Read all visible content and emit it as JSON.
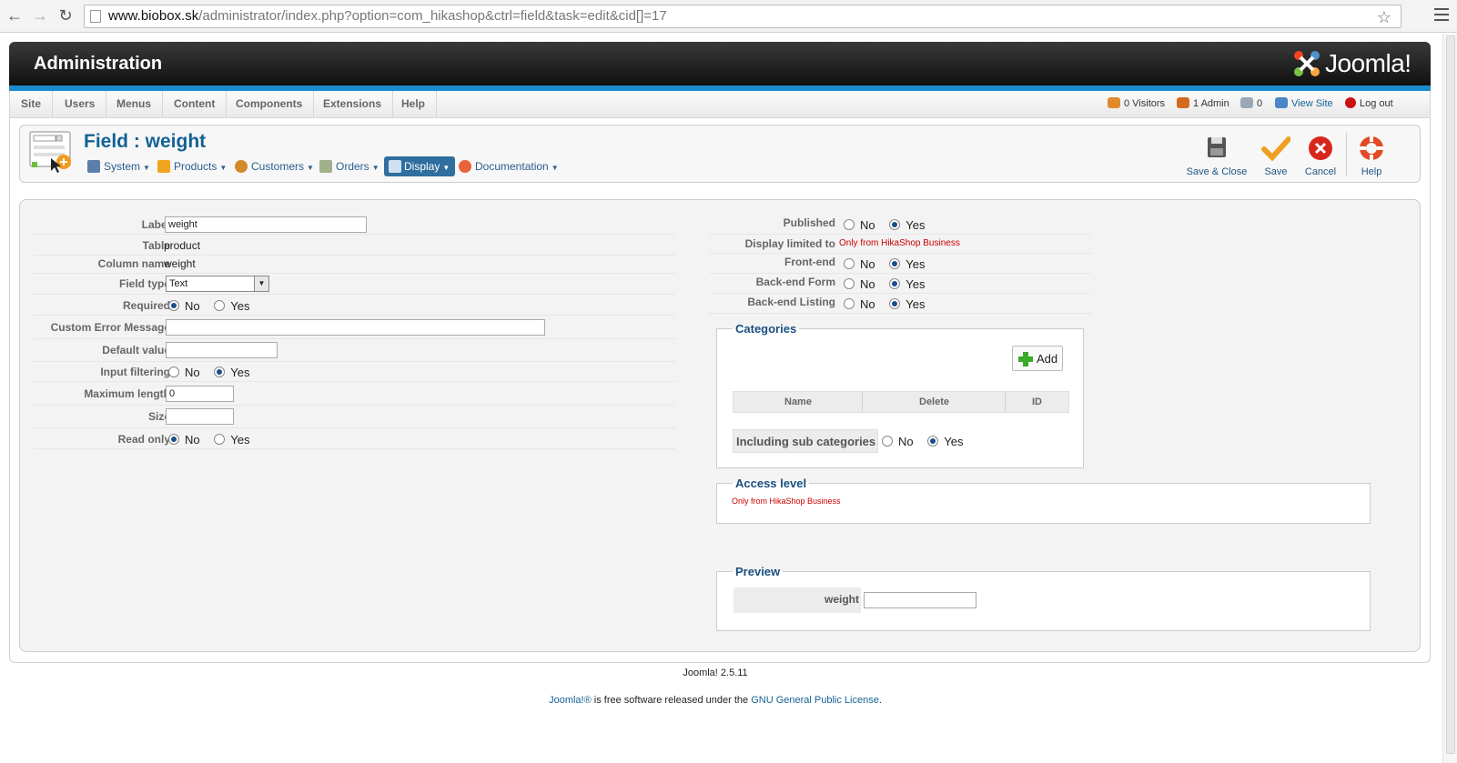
{
  "browser": {
    "url_host": "www.biobox.sk",
    "url_path": "/administrator/index.php?option=com_hikashop&ctrl=field&task=edit&cid[]=17"
  },
  "header": {
    "title": "Administration",
    "logo_text": "Joomla!"
  },
  "menubar": {
    "items": [
      "Site",
      "Users",
      "Menus",
      "Content",
      "Components",
      "Extensions",
      "Help"
    ],
    "status": {
      "visitors": "0 Visitors",
      "admins": "1 Admin",
      "messages": "0",
      "view_site": "View Site",
      "logout": "Log out"
    }
  },
  "toolbar": {
    "page_title": "Field : weight",
    "hika_menu": [
      "System",
      "Products",
      "Customers",
      "Orders",
      "Display",
      "Documentation"
    ],
    "active_menu": "Display",
    "buttons": {
      "save_close": "Save & Close",
      "save": "Save",
      "cancel": "Cancel",
      "help": "Help"
    }
  },
  "form_left": {
    "label_label": "Label",
    "label_value": "weight",
    "table_label": "Table",
    "table_value": "product",
    "column_label": "Column name",
    "column_value": "weight",
    "fieldtype_label": "Field type",
    "fieldtype_value": "Text",
    "required_label": "Required",
    "custom_error_label": "Custom Error Message",
    "custom_error_value": "",
    "default_label": "Default value",
    "default_value": "",
    "input_filtering_label": "Input filtering",
    "max_length_label": "Maximum length",
    "max_length_value": "0",
    "size_label": "Size",
    "size_value": "",
    "readonly_label": "Read only",
    "no": "No",
    "yes": "Yes"
  },
  "form_right": {
    "published_label": "Published",
    "display_limited_label": "Display limited to",
    "display_limited_value": "Only from HikaShop Business",
    "frontend_label": "Front-end",
    "backend_form_label": "Back-end Form",
    "backend_listing_label": "Back-end Listing",
    "no": "No",
    "yes": "Yes"
  },
  "categories": {
    "legend": "Categories",
    "add_label": "Add",
    "col_name": "Name",
    "col_delete": "Delete",
    "col_id": "ID",
    "including_label": "Including sub categories"
  },
  "access_level": {
    "legend": "Access level",
    "note": "Only from HikaShop Business"
  },
  "preview": {
    "legend": "Preview",
    "field_label": "weight",
    "field_value": ""
  },
  "footer": {
    "version": "Joomla! 2.5.11",
    "license_prefix": "Joomla!®",
    "license_mid": " is free software released under the ",
    "license_link": "GNU General Public License",
    "license_suffix": "."
  },
  "colors": {
    "accent_blue": "#1d8acb",
    "title_blue": "#146295",
    "note_red": "#cc0000"
  }
}
